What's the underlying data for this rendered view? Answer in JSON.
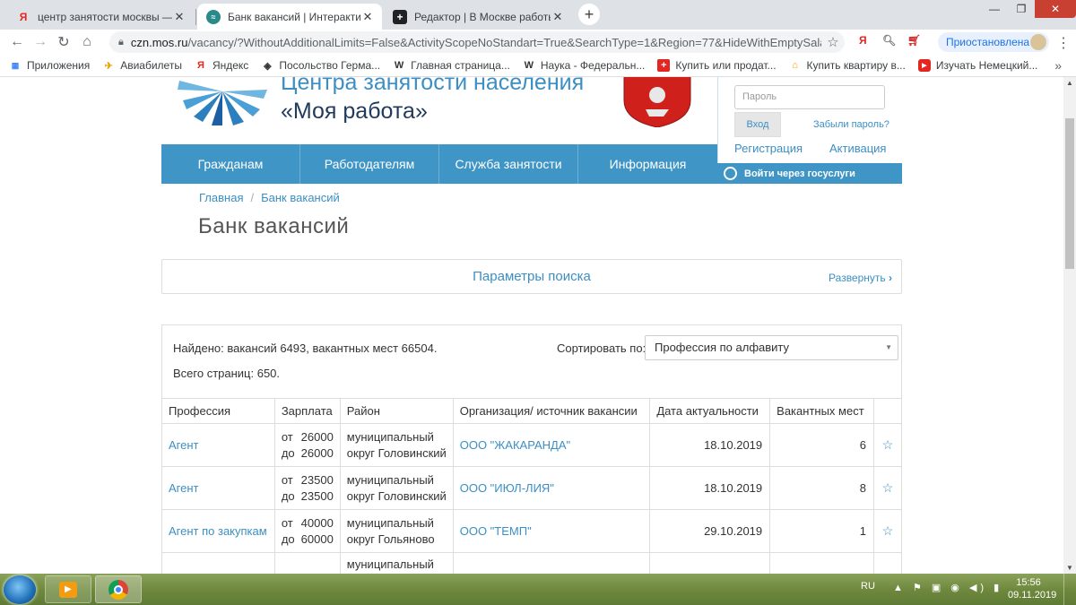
{
  "browser": {
    "tabs": [
      {
        "title": "центр занятости москвы — Янд",
        "favicon": "yandex-icon",
        "active": false
      },
      {
        "title": "Банк вакансий | Интерактивный",
        "favicon": "czn-icon",
        "active": true
      },
      {
        "title": "Редактор | В Москве работы ва",
        "favicon": "editor-icon",
        "active": false
      }
    ],
    "url_host": "czn.mos.ru",
    "url_path": "/vacancy/?WithoutAdditionalLimits=False&ActivityScopeNoStandart=True&SearchType=1&Region=77&HideWithEmptySalary...",
    "profile_status": "Приостановлена",
    "bookmarks": [
      {
        "label": "Приложения",
        "icon": "apps-grid-icon"
      },
      {
        "label": "Авиабилеты",
        "icon": "plane-icon"
      },
      {
        "label": "Яндекс",
        "icon": "yandex-icon"
      },
      {
        "label": "Посольство Герма...",
        "icon": "cube-icon"
      },
      {
        "label": "Главная страница...",
        "icon": "wiki-icon"
      },
      {
        "label": "Наука - Федеральн...",
        "icon": "wiki-icon"
      },
      {
        "label": "Купить или продат...",
        "icon": "avito-icon"
      },
      {
        "label": "Купить квартиру в...",
        "icon": "house-icon"
      },
      {
        "label": "Изучать Немецкий...",
        "icon": "youtube-icon"
      }
    ],
    "bookmarks_more": "»"
  },
  "site": {
    "brand_line1": "Центра занятости населения",
    "brand_line2": "«Моя работа»",
    "login": {
      "password_placeholder": "Пароль",
      "login_button": "Вход",
      "forgot": "Забыли пароль?",
      "register": "Регистрация",
      "activate": "Активация"
    },
    "nav": [
      "Гражданам",
      "Работодателям",
      "Служба занятости",
      "Информация"
    ],
    "gosuslugi": "Войти через госуслуги",
    "breadcrumbs": [
      "Главная",
      "Банк вакансий"
    ],
    "page_title": "Банк вакансий",
    "search_params": {
      "title": "Параметры поиска",
      "expand": "Развернуть"
    },
    "results": {
      "found": "Найдено: вакансий 6493, вакантных мест 66504.",
      "pages": "Всего страниц: 650.",
      "sort_label": "Сортировать по:",
      "sort_value": "Профессия по алфавиту",
      "columns": [
        "Профессия",
        "Зарплата",
        "Район",
        "Организация/ источник вакансии",
        "Дата актуальности",
        "Вакантных мест",
        ""
      ],
      "rows": [
        {
          "profession": "Агент",
          "from_label": "от",
          "from": "26000",
          "to_label": "до",
          "to": "26000",
          "district_1": "муниципальный",
          "district_2": "округ Головинский",
          "org": "ООО \"ЖАКАРАНДА\"",
          "date": "18.10.2019",
          "count": "6"
        },
        {
          "profession": "Агент",
          "from_label": "от",
          "from": "23500",
          "to_label": "до",
          "to": "23500",
          "district_1": "муниципальный",
          "district_2": "округ Головинский",
          "org": "ООО \"ИЮЛ-ЛИЯ\"",
          "date": "18.10.2019",
          "count": "8"
        },
        {
          "profession": "Агент по закупкам",
          "from_label": "от",
          "from": "40000",
          "to_label": "до",
          "to": "60000",
          "district_1": "муниципальный",
          "district_2": "округ Гольяново",
          "org": "ООО \"ТЕМП\"",
          "date": "29.10.2019",
          "count": "1"
        },
        {
          "profession": "",
          "from_label": "",
          "from": "",
          "to_label": "",
          "to": "",
          "district_1": "муниципальный",
          "district_2": "",
          "org": "",
          "date": "",
          "count": ""
        }
      ]
    }
  },
  "taskbar": {
    "lang": "RU",
    "time": "15:56",
    "date": "09.11.2019"
  },
  "colors": {
    "accent": "#3b8fc4",
    "nav": "#3f96c6"
  }
}
